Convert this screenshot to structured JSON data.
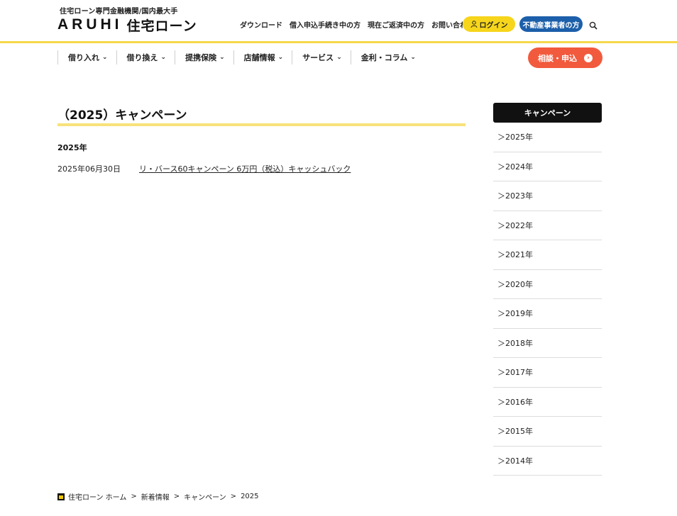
{
  "header": {
    "tagline": "住宅ローン専門金融機関/国内最大手",
    "logo_latin_a": "AR",
    "logo_latin_u": "U",
    "logo_latin_b": "HI",
    "logo_jp": "住宅ローン",
    "top_links": [
      "ダウンロード",
      "借入申込手続き中の方",
      "現在ご返済中の方",
      "お問い合わせ"
    ],
    "login_label": "ログイン",
    "realestate_label": "不動産事業者の方",
    "accent_color": "#f6d84a"
  },
  "mainnav": {
    "items": [
      "借り入れ",
      "借り換え",
      "提携保険",
      "店舗情報",
      "サービス",
      "金利・コラム"
    ],
    "consult_label": "相談・申込"
  },
  "content": {
    "title": "（2025）キャンペーン",
    "year_heading": "2025年",
    "news": [
      {
        "date": "2025年06月30日",
        "title": "リ・バース60キャンペーン 6万円（税込）キャッシュバック"
      }
    ]
  },
  "sidebar": {
    "heading": "キャンペーン",
    "years": [
      "＞2025年",
      "＞2024年",
      "＞2023年",
      "＞2022年",
      "＞2021年",
      "＞2020年",
      "＞2019年",
      "＞2018年",
      "＞2017年",
      "＞2016年",
      "＞2015年",
      "＞2014年"
    ]
  },
  "breadcrumb": {
    "items": [
      "住宅ローン ホーム",
      "新着情報",
      "キャンペーン",
      "2025"
    ],
    "separator": ">"
  }
}
